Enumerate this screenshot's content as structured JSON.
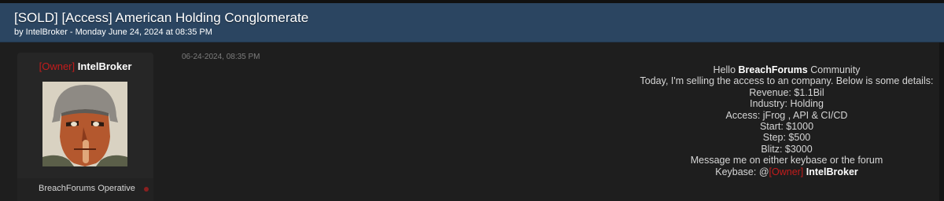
{
  "thread": {
    "title": "[SOLD] [Access] American Holding Conglomerate",
    "byline": "by IntelBroker - Monday June 24, 2024 at 08:35 PM"
  },
  "author": {
    "tag": "[Owner]",
    "name": "IntelBroker",
    "rank": "BreachForums Operative",
    "status_color": "#8a1f1f"
  },
  "post": {
    "date": "06-24-2024, 08:35 PM",
    "greeting_prefix": "Hello ",
    "greeting_bold": "BreachForums",
    "greeting_suffix": " Community",
    "intro": "Today, I'm selling the access to an company. Below is some details:",
    "revenue": "Revenue: $1.1Bil",
    "industry": "Industry: Holding",
    "access": "Access: jFrog , API & CI/CD",
    "start": "Start: $1000",
    "step": "Step: $500",
    "blitz": "Blitz: $3000",
    "contact": "Message me on either keybase or the forum",
    "keybase_prefix": "Keybase: @",
    "keybase_tag": "[Owner]",
    "keybase_name": "IntelBroker"
  },
  "colors": {
    "header_bg": "#2b4561",
    "owner_tag": "#c41c1c",
    "page_bg": "#1e1e1e"
  }
}
